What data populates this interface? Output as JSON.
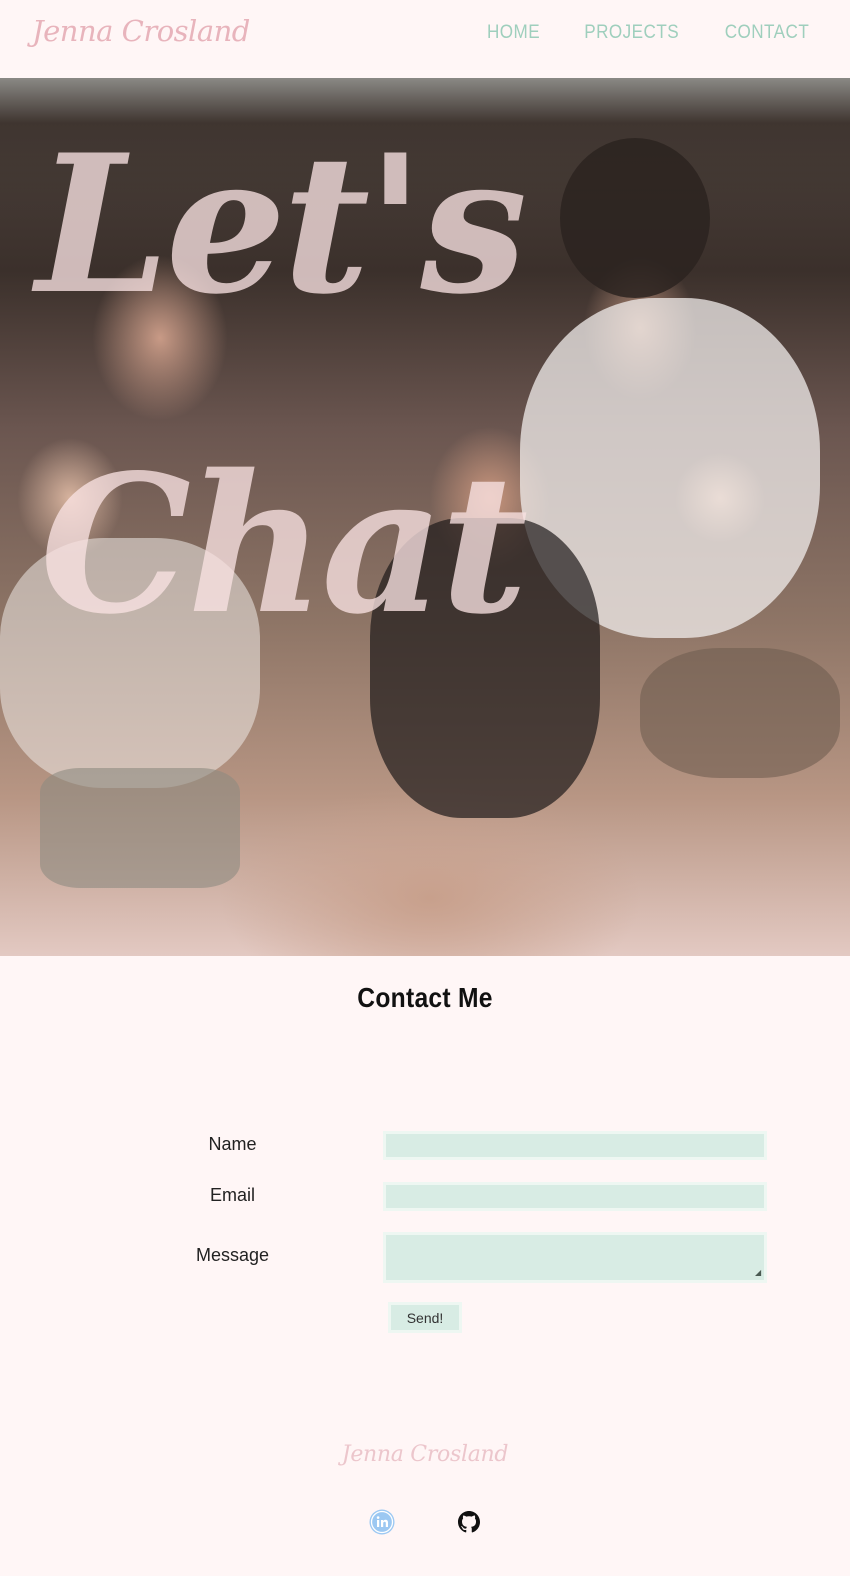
{
  "header": {
    "logo": "Jenna Crosland",
    "nav": [
      {
        "label": "HOME"
      },
      {
        "label": "PROJECTS"
      },
      {
        "label": "CONTACT"
      }
    ]
  },
  "hero": {
    "line1": "Let's",
    "line2": "Chat"
  },
  "contact": {
    "title": "Contact Me",
    "fields": {
      "name": {
        "label": "Name",
        "value": ""
      },
      "email": {
        "label": "Email",
        "value": ""
      },
      "message": {
        "label": "Message",
        "value": ""
      }
    },
    "send_label": "Send!"
  },
  "footer": {
    "logo": "Jenna Crosland",
    "social": [
      {
        "icon": "linkedin-icon"
      },
      {
        "icon": "github-icon"
      }
    ]
  },
  "colors": {
    "background": "#fff6f6",
    "logo_pink": "#e8b4bc",
    "nav_mint": "#9fcfbd",
    "input_mint": "#d8ece4"
  }
}
